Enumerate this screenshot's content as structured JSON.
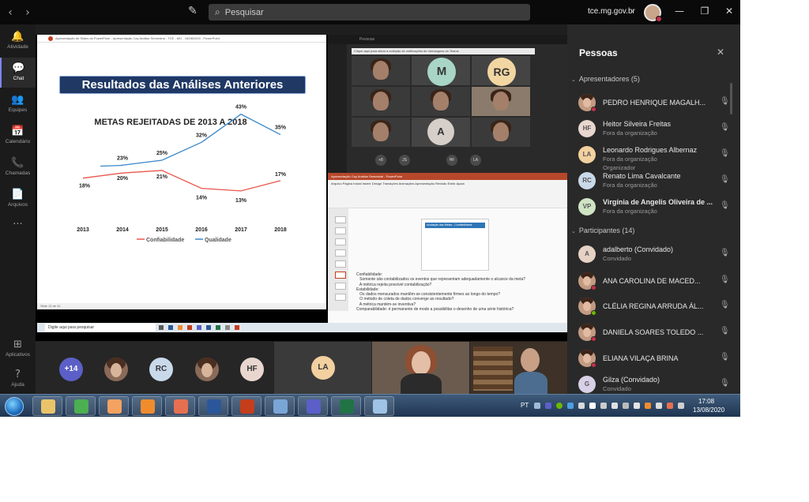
{
  "titlebar": {
    "back": "‹",
    "forward": "›",
    "search_placeholder": "Pesquisar",
    "org": "tce.mg.gov.br",
    "org_chevron": "⌄",
    "minimize": "—",
    "maximize": "❐",
    "close": "✕"
  },
  "rail": {
    "items": [
      {
        "label": "Atividade",
        "icon": "bell-icon",
        "glyph": "🔔"
      },
      {
        "label": "Chat",
        "icon": "chat-icon",
        "glyph": "💬"
      },
      {
        "label": "Equipes",
        "icon": "teams-icon",
        "glyph": "👥"
      },
      {
        "label": "Calendário",
        "icon": "calendar-icon",
        "glyph": "📅"
      },
      {
        "label": "Chamadas",
        "icon": "phone-icon",
        "glyph": "📞"
      },
      {
        "label": "Arquivos",
        "icon": "files-icon",
        "glyph": "📄"
      },
      {
        "label": "",
        "icon": "more-icon",
        "glyph": "···"
      }
    ],
    "bottom": [
      {
        "label": "Aplicativos",
        "icon": "apps-icon",
        "glyph": "⊞"
      },
      {
        "label": "Ajuda",
        "icon": "help-icon",
        "glyph": "?"
      }
    ]
  },
  "shared_screen": {
    "ppt_title": "Apresentação de Slides do PowerPoint - Apresentação Caç Análise Semestral - TCE - MG - 15/08/2020 - PowerPoint",
    "slide_banner": "Resultados das Análises Anteriores",
    "status_text": "Slide 13 de 41",
    "teams_mini_title": "Pessoas",
    "notice_text": "Clique aqui para ativar a exibição de notificações de mensagens do Teams",
    "ppt2_title": "Apresentação Caç Análise Semestral - PowerPoint",
    "ppt2_tabs": "Arquivo  Página Inicial  Inserir  Design  Transições  Animações  Apresentação  Revisão  Exibir  Ajuda",
    "ppt2_slide_title": "Avaliação das Metas - Confiabilidade",
    "ppt2_notes": [
      "Confiabilidade:",
      "   Somente são contabilizados os eventos que representam adequadamente o alcance da meta?",
      "   A métrica rejeita possível contabilização?",
      "Estabilidade:",
      "   Os dados mensurados mantêm-se consistentemente firmes ao longo do tempo?",
      "   O método de coleta de dados converge ao resultado?",
      "   A métrica mantém-se inventiva?",
      "Comparabilidade: é permanente de modo a possibilitar o desenho de uma série histórica?"
    ],
    "taskbar_search": "Digite aqui para pesquisar",
    "mini_avatars": [
      {
        "initials": "M",
        "color": "#a8d5c6"
      },
      {
        "initials": "RG",
        "color": "#f2d6a2"
      },
      {
        "initials": "A",
        "color": "#d6cfc9"
      }
    ],
    "mini_dots": [
      "+8",
      "JS",
      "HF",
      "LA"
    ]
  },
  "chart_data": {
    "type": "line",
    "title": "METAS REJEITADAS DE 2013 A 2018",
    "categories": [
      "2013",
      "2014",
      "2015",
      "2016",
      "2017",
      "2018"
    ],
    "series": [
      {
        "name": "Confiabilidade",
        "color": "#e8574d",
        "values": [
          18,
          20,
          21,
          14,
          13,
          17
        ],
        "labels": [
          "18%",
          "20%",
          "21%",
          "14%",
          "13%",
          "17%"
        ]
      },
      {
        "name": "Qualidade",
        "color": "#3a86c8",
        "values": [
          null,
          23,
          25,
          32,
          43,
          35
        ],
        "labels": [
          "",
          "23%",
          "25%",
          "32%",
          "43%",
          "35%"
        ]
      }
    ],
    "ylim": [
      0,
      50
    ],
    "grid": false,
    "legend": "bottom"
  },
  "strip": {
    "overflow": "+14",
    "avatars": [
      {
        "initials": "RC",
        "color": "#c9d9ea"
      },
      {
        "initials": "HF",
        "color": "#e8d6cf"
      },
      {
        "initials": "LA",
        "color": "#f2d09f"
      }
    ]
  },
  "people": {
    "title": "Pessoas",
    "close": "✕",
    "presenters_header": "Apresentadores (5)",
    "participants_header": "Participantes (14)",
    "presenters": [
      {
        "name": "PEDRO HENRIQUE MAGALH...",
        "sub": "",
        "sub2": "",
        "initials": "",
        "photo": true,
        "avatar_color": "",
        "status": "#c4314b"
      },
      {
        "name": "Heitor Silveira Freitas",
        "sub": "Fora da organização",
        "sub2": "",
        "initials": "HF",
        "photo": false,
        "avatar_color": "#e8d6cf",
        "status": ""
      },
      {
        "name": "Leonardo Rodrigues Albernaz",
        "sub": "Fora da organização",
        "sub2": "Organizador",
        "initials": "LA",
        "photo": false,
        "avatar_color": "#f2d09f",
        "status": ""
      },
      {
        "name": "Renato Lima Cavalcante",
        "sub": "Fora da organização",
        "sub2": "",
        "initials": "RC",
        "photo": false,
        "avatar_color": "#c9d9ea",
        "status": ""
      },
      {
        "name": "Virgínia de Angelis Oliveira de ...",
        "sub": "Fora da organização",
        "sub2": "",
        "initials": "VP",
        "photo": false,
        "avatar_color": "#cfe4c4",
        "status": ""
      }
    ],
    "participants": [
      {
        "name": "adalberto (Convidado)",
        "sub": "Convidado",
        "initials": "A",
        "photo": false,
        "avatar_color": "#e6d2c4",
        "status": ""
      },
      {
        "name": "ANA CAROLINA DE MACED...",
        "sub": "",
        "initials": "",
        "photo": true,
        "avatar_color": "",
        "status": "#c4314b"
      },
      {
        "name": "CLÉLIA REGINA ARRUDA ÁL...",
        "sub": "",
        "initials": "",
        "photo": true,
        "avatar_color": "",
        "status": "#6bb700"
      },
      {
        "name": "DANIELA SOARES TOLEDO ...",
        "sub": "",
        "initials": "",
        "photo": true,
        "avatar_color": "",
        "status": "#c4314b"
      },
      {
        "name": "ELIANA VILAÇA BRINA",
        "sub": "",
        "initials": "",
        "photo": true,
        "avatar_color": "",
        "status": "#c4314b"
      },
      {
        "name": "Gilza (Convidado)",
        "sub": "Convidado",
        "initials": "G",
        "photo": false,
        "avatar_color": "#d7d0e6",
        "status": ""
      }
    ],
    "mic_glyph": "🎙"
  },
  "taskbar": {
    "lang": "PT",
    "time": "17:08",
    "date": "13/08/2020",
    "apps": [
      {
        "name": "explorer-icon",
        "color": "#e9c46a"
      },
      {
        "name": "chrome-icon",
        "color": "#4caf50"
      },
      {
        "name": "media-player-icon",
        "color": "#f4a261"
      },
      {
        "name": "settings-icon",
        "color": "#f08c2e"
      },
      {
        "name": "firefox-icon",
        "color": "#e76f51"
      },
      {
        "name": "word-icon",
        "color": "#2b579a"
      },
      {
        "name": "powerpoint-icon",
        "color": "#c43e1c"
      },
      {
        "name": "network-icon",
        "color": "#7aa6d6"
      },
      {
        "name": "teams-icon",
        "color": "#5b5fc7"
      },
      {
        "name": "excel-icon",
        "color": "#217346"
      },
      {
        "name": "paint-icon",
        "color": "#9ec3e6"
      }
    ]
  }
}
